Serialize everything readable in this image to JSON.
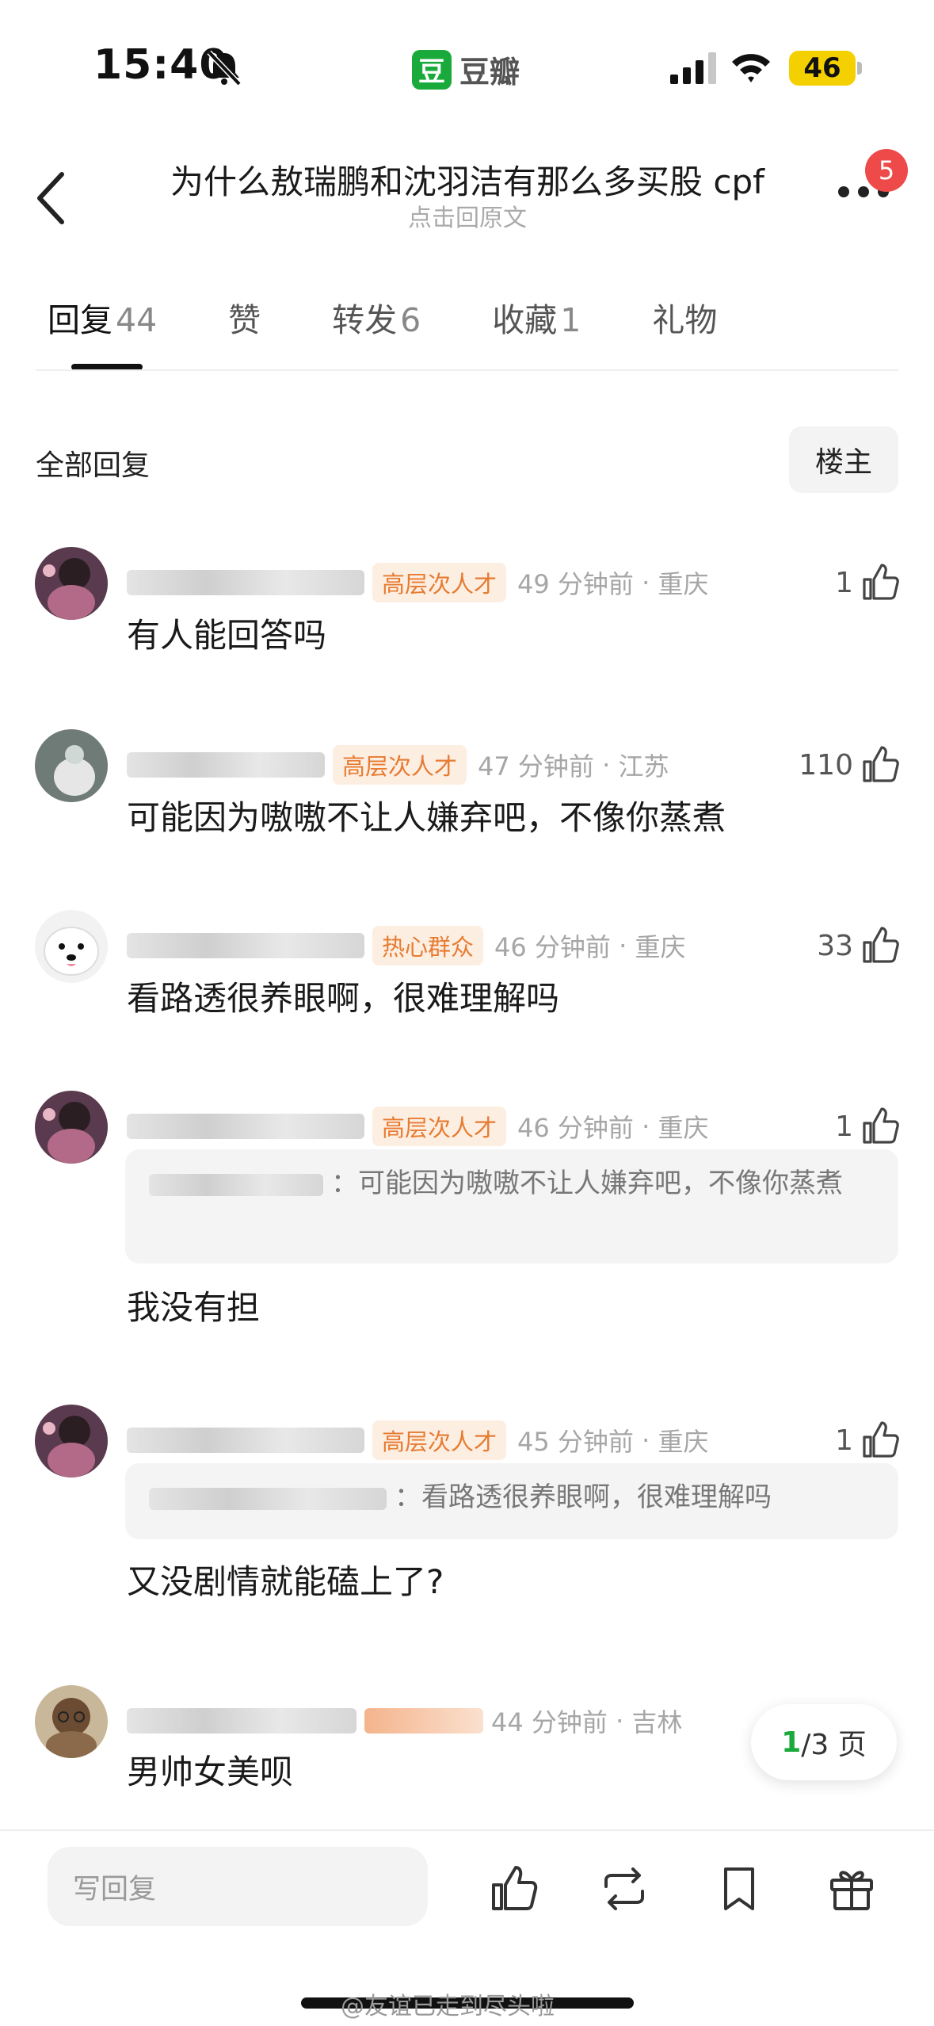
{
  "status_bar": {
    "time": "15:40",
    "app_name": "豆瓣",
    "app_logo_char": "豆",
    "battery": "46"
  },
  "header": {
    "title": "为什么敖瑞鹏和沈羽洁有那么多买股 cpf",
    "subtitle": "点击回原文",
    "notification_count": "5"
  },
  "tabs": [
    {
      "label": "回复",
      "count": "44"
    },
    {
      "label": "赞",
      "count": ""
    },
    {
      "label": "转发",
      "count": "6"
    },
    {
      "label": "收藏",
      "count": "1"
    },
    {
      "label": "礼物",
      "count": ""
    }
  ],
  "section": {
    "title": "全部回复",
    "op_filter_label": "楼主"
  },
  "comments": [
    {
      "tag": "高层次人才",
      "time": "49 分钟前",
      "location": "重庆",
      "likes": "1",
      "text": "有人能回答吗"
    },
    {
      "tag": "高层次人才",
      "time": "47 分钟前",
      "location": "江苏",
      "likes": "110",
      "text": "可能因为嗷嗷不让人嫌弃吧，不像你蒸煮"
    },
    {
      "tag": "热心群众",
      "time": "46 分钟前",
      "location": "重庆",
      "likes": "33",
      "text": "看路透很养眼啊，很难理解吗"
    },
    {
      "tag": "高层次人才",
      "time": "46 分钟前",
      "location": "重庆",
      "likes": "1",
      "quote": "：可能因为嗷嗷不让人嫌弃吧，不像你蒸煮",
      "text": "我没有担"
    },
    {
      "tag": "高层次人才",
      "time": "45 分钟前",
      "location": "重庆",
      "likes": "1",
      "quote": "：看路透很养眼啊，很难理解吗",
      "text": "又没剧情就能磕上了?"
    },
    {
      "time": "44 分钟前",
      "location": "吉林",
      "text": "男帅女美呗"
    }
  ],
  "pagination": {
    "current": "1",
    "total": "/3 页"
  },
  "bottom_bar": {
    "reply_placeholder": "写回复"
  },
  "watermark": "@友谊已走到尽头啦",
  "colors": {
    "brand_green": "#1aaa3c",
    "tag_orange": "#e77b31",
    "badge_red": "#ef4a4a"
  }
}
